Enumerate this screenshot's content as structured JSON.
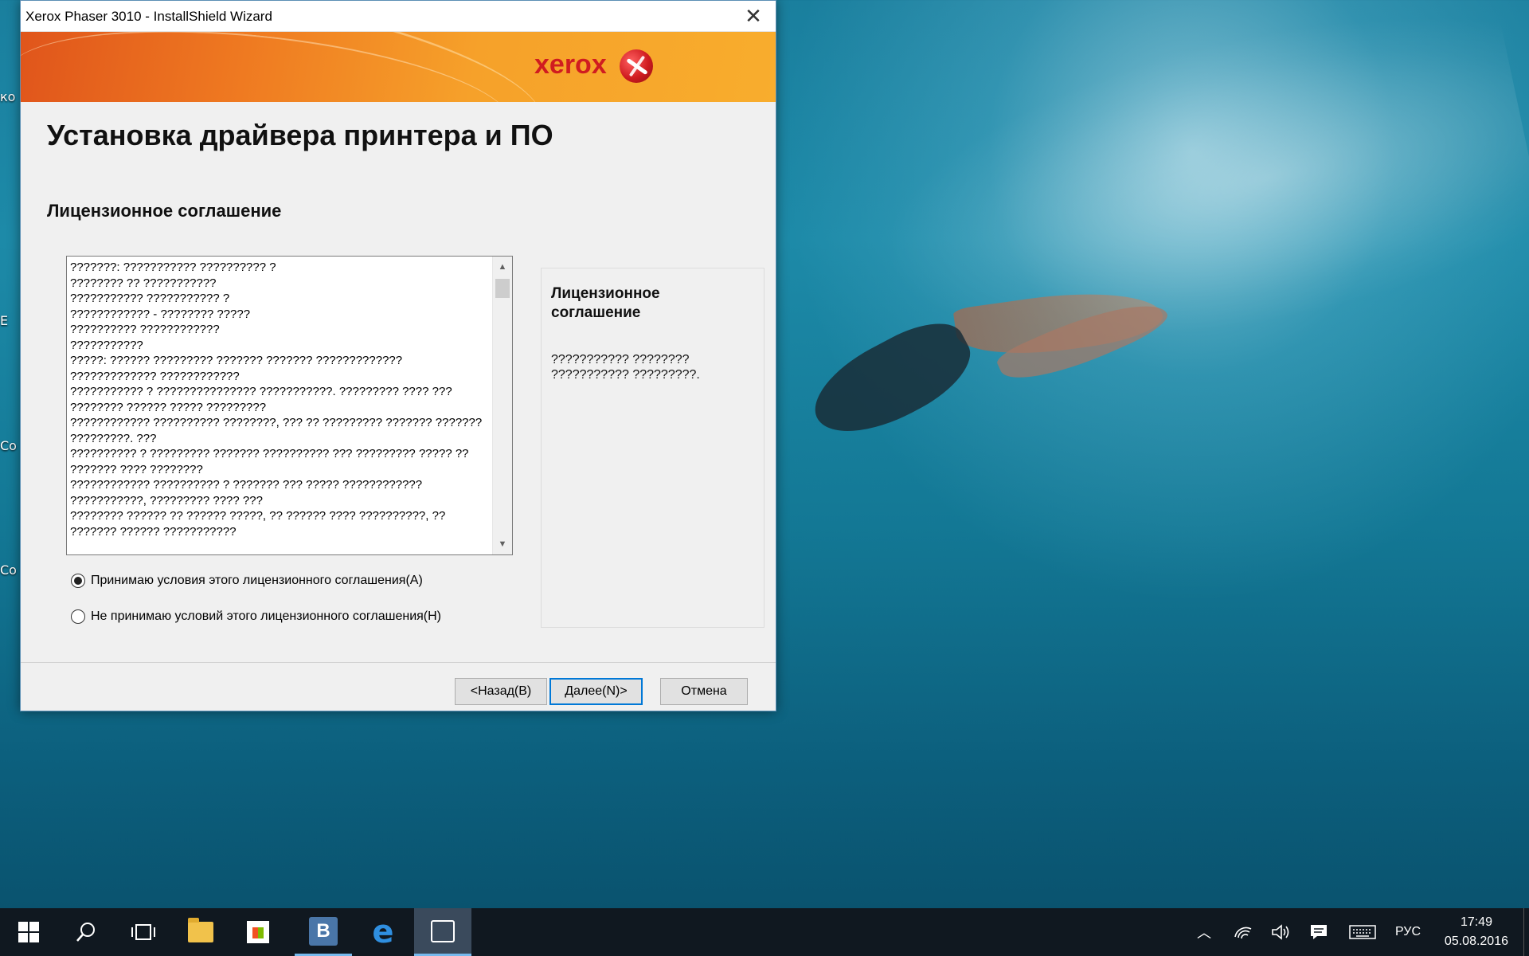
{
  "window": {
    "title": "Xerox Phaser 3010 - InstallShield Wizard",
    "brand": "xerox",
    "main_title": "Установка драйвера принтера и ПО",
    "section_title": "Лицензионное соглашение",
    "license_text": "???????: ??????????? ?????????? ?\n???????? ?? ???????????\n??????????? ??????????? ?\n???????????? - ???????? ?????\n?????????? ????????????\n???????????\n?????: ?????? ????????? ??????? ??????? ?????????????\n????????????? ????????????\n??????????? ? ??????????????? ???????????. ????????? ???? ??? ???????? ?????? ????? ?????????\n???????????? ?????????? ????????, ??? ?? ????????? ??????? ??????? ?????????. ???\n?????????? ? ????????? ??????? ?????????? ??? ????????? ????? ?? ??????? ???? ????????\n???????????? ?????????? ? ??????? ??? ????? ???????????? ???????????, ????????? ???? ???\n???????? ?????? ?? ?????? ?????, ?? ?????? ???? ??????????, ?? ??????? ?????? ???????????",
    "radio_accept": "Принимаю условия этого лицензионного соглашения(A)",
    "radio_decline": "Не принимаю условий этого лицензионного соглашения(H)",
    "accept_selected": true,
    "info_heading": "Лицензионное соглашение",
    "info_desc": "??????????? ???????? ??????????? ?????????.",
    "buttons": {
      "back": "<Назад(B)",
      "next": "Далее(N)>",
      "cancel": "Отмена"
    }
  },
  "desktop": {
    "edge_labels": [
      "ко",
      "Е",
      "Со",
      "Со"
    ]
  },
  "taskbar": {
    "items": [
      "start-icon",
      "search-icon",
      "task-view-icon",
      "file-explorer-icon",
      "store-icon",
      "vk-icon",
      "edge-icon",
      "installer-icon"
    ],
    "vk_letter": "В",
    "language": "РУС",
    "time": "17:49",
    "date": "05.08.2016"
  }
}
